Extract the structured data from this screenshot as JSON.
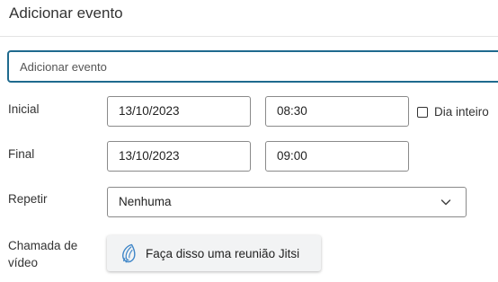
{
  "dialog": {
    "title": "Adicionar evento"
  },
  "event": {
    "title_placeholder": "Adicionar evento",
    "title_value": ""
  },
  "start": {
    "label": "Inicial",
    "date": "13/10/2023",
    "time": "08:30"
  },
  "end": {
    "label": "Final",
    "date": "13/10/2023",
    "time": "09:00"
  },
  "all_day": {
    "label": "Dia inteiro",
    "checked": false
  },
  "repeat": {
    "label": "Repetir",
    "selected": "Nenhuma"
  },
  "video": {
    "label_line1": "Chamada de",
    "label_line2": "vídeo",
    "button_label": "Faça disso uma reunião Jitsi",
    "icon": "jitsi-logo-icon"
  },
  "colors": {
    "accent": "#1f6a8e",
    "jitsi_icon": "#3f86c8"
  }
}
